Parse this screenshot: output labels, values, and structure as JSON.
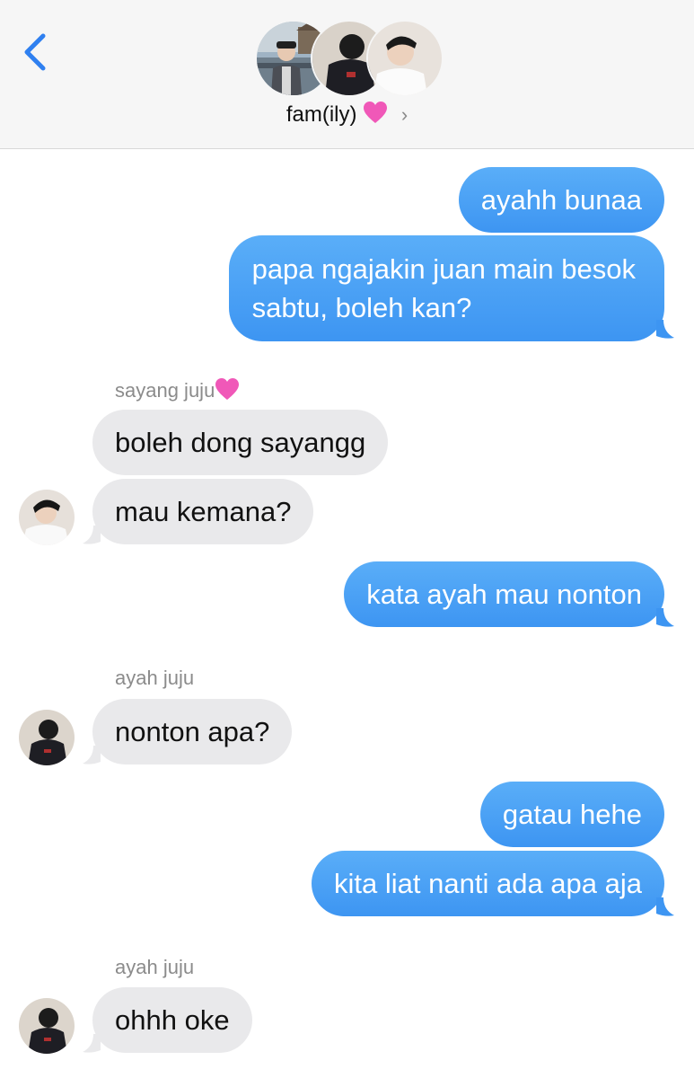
{
  "header": {
    "title": "fam(ily)",
    "title_emoji": "💗",
    "chevron": "›",
    "back_icon": "chevron-left-icon"
  },
  "colors": {
    "outgoing_bubble": "#3d95f2",
    "incoming_bubble": "#e9e9eb",
    "back_accent": "#2f80f0",
    "sender_label": "#8b8b8b"
  },
  "messages": [
    {
      "id": "m1",
      "dir": "out",
      "text": "ayahh bunaa"
    },
    {
      "id": "m2",
      "dir": "out",
      "line1": "papa ngajakin juan main besok",
      "line2": "sabtu, boleh kan?"
    },
    {
      "id": "s1",
      "sender": "sayang juju",
      "sender_emoji": "💗"
    },
    {
      "id": "m3",
      "dir": "in",
      "text": "boleh dong sayangg"
    },
    {
      "id": "m4",
      "dir": "in",
      "text": "mau kemana?"
    },
    {
      "id": "m5",
      "dir": "out",
      "text": "kata ayah mau nonton"
    },
    {
      "id": "s2",
      "sender": "ayah juju"
    },
    {
      "id": "m6",
      "dir": "in",
      "text": "nonton apa?"
    },
    {
      "id": "m7",
      "dir": "out",
      "text": "gatau hehe"
    },
    {
      "id": "m8",
      "dir": "out",
      "text": "kita liat nanti ada apa aja"
    },
    {
      "id": "s3",
      "sender": "ayah juju"
    },
    {
      "id": "m9",
      "dir": "in",
      "text": "ohhh oke"
    }
  ],
  "conv": {
    "m1": "ayahh bunaa",
    "m2a": "papa ngajakin juan main besok",
    "m2b": "sabtu, boleh kan?",
    "s1": "sayang juju",
    "m3": "boleh dong sayangg",
    "m4": "mau kemana?",
    "m5": "kata ayah mau nonton",
    "s2": "ayah juju",
    "m6": "nonton apa?",
    "m7": "gatau hehe",
    "m8": "kita liat nanti ada apa aja",
    "s3": "ayah juju",
    "m9": "ohhh oke"
  }
}
